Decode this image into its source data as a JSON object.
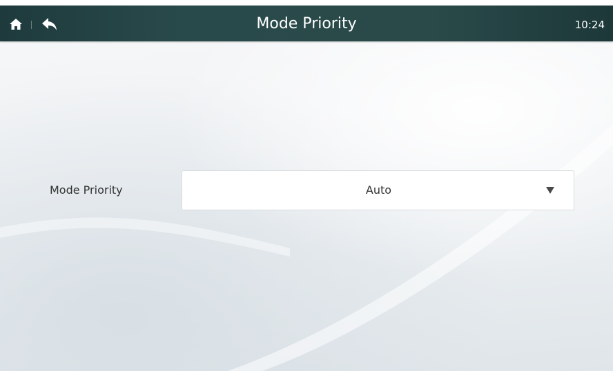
{
  "header": {
    "title": "Mode Priority",
    "time": "10:24",
    "home_icon": "home-icon",
    "back_icon": "back-arrow-icon"
  },
  "setting": {
    "label": "Mode Priority",
    "selected_value": "Auto",
    "arrow_icon": "dropdown-arrow-icon"
  },
  "colors": {
    "header_bg": "#294a4b",
    "header_text": "#ffffff",
    "label_text": "#333333",
    "dropdown_bg": "#ffffff",
    "dropdown_border": "#d9dcdf"
  }
}
